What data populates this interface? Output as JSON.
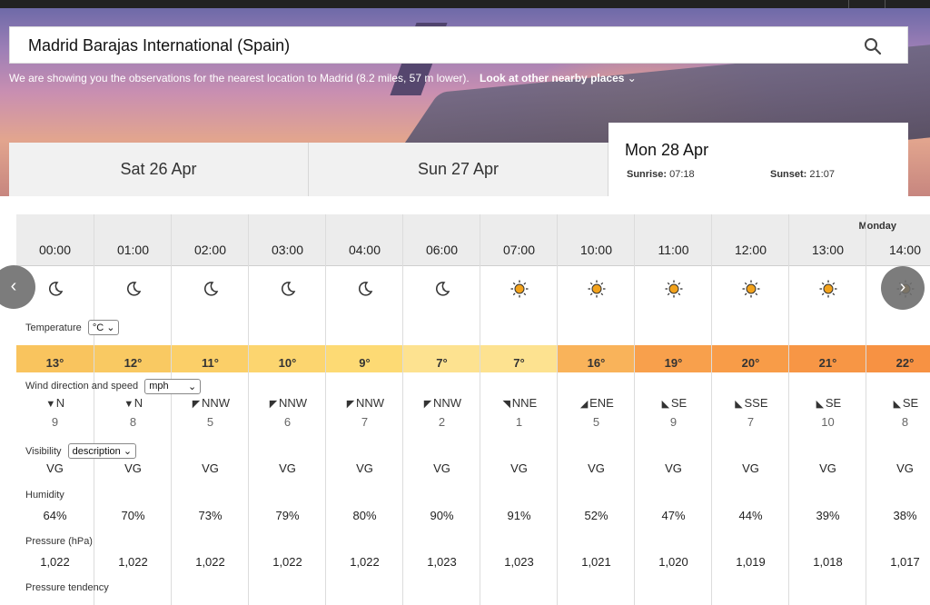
{
  "search": {
    "value": "Madrid Barajas International (Spain)"
  },
  "nearest": {
    "text": "We are showing you the observations for the nearest location to Madrid (8.2 miles, 57 m lower).",
    "link": "Look at other nearby places"
  },
  "days": [
    {
      "label": "Sat 26 Apr"
    },
    {
      "label": "Sun 27 Apr"
    },
    {
      "label": "Mon 28 Apr",
      "sunrise_label": "Sunrise:",
      "sunrise": "07:18",
      "sunset_label": "Sunset:",
      "sunset": "21:07"
    }
  ],
  "table": {
    "day_name": "Monday",
    "labels": {
      "temperature": "Temperature",
      "temp_unit": "°C",
      "wind": "Wind direction and speed",
      "wind_unit": "mph",
      "visibility": "Visibility",
      "visibility_mode": "description",
      "humidity": "Humidity",
      "pressure": "Pressure (hPa)",
      "pressure_tendency": "Pressure tendency"
    },
    "hours": [
      {
        "time": "00:00",
        "icon": "moon-icon",
        "temp": "13°",
        "tempColor": "#f9c45e",
        "arrow": "▼",
        "dir": "N",
        "speed": "9",
        "vis": "VG",
        "hum": "64%",
        "pres": "1,022"
      },
      {
        "time": "01:00",
        "icon": "moon-icon",
        "temp": "12°",
        "tempColor": "#f9c962",
        "arrow": "▼",
        "dir": "N",
        "speed": "8",
        "vis": "VG",
        "hum": "70%",
        "pres": "1,022"
      },
      {
        "time": "02:00",
        "icon": "moon-icon",
        "temp": "11°",
        "tempColor": "#fbcf68",
        "arrow": "◤",
        "dir": "NNW",
        "speed": "5",
        "vis": "VG",
        "hum": "73%",
        "pres": "1,022"
      },
      {
        "time": "03:00",
        "icon": "moon-icon",
        "temp": "10°",
        "tempColor": "#fcd56f",
        "arrow": "◤",
        "dir": "NNW",
        "speed": "6",
        "vis": "VG",
        "hum": "79%",
        "pres": "1,022"
      },
      {
        "time": "04:00",
        "icon": "moon-icon",
        "temp": "9°",
        "tempColor": "#fdda74",
        "arrow": "◤",
        "dir": "NNW",
        "speed": "7",
        "vis": "VG",
        "hum": "80%",
        "pres": "1,022"
      },
      {
        "time": "06:00",
        "icon": "moon-icon",
        "temp": "7°",
        "tempColor": "#fde290",
        "arrow": "◤",
        "dir": "NNW",
        "speed": "2",
        "vis": "VG",
        "hum": "90%",
        "pres": "1,023"
      },
      {
        "time": "07:00",
        "icon": "sun-icon",
        "temp": "7°",
        "tempColor": "#fde290",
        "arrow": "◥",
        "dir": "NNE",
        "speed": "1",
        "vis": "VG",
        "hum": "91%",
        "pres": "1,023"
      },
      {
        "time": "10:00",
        "icon": "sun-icon",
        "temp": "16°",
        "tempColor": "#f9b35a",
        "arrow": "◢",
        "dir": "ENE",
        "speed": "5",
        "vis": "VG",
        "hum": "52%",
        "pres": "1,021"
      },
      {
        "time": "11:00",
        "icon": "sun-icon",
        "temp": "19°",
        "tempColor": "#f8a04c",
        "arrow": "◣",
        "dir": "SE",
        "speed": "9",
        "vis": "VG",
        "hum": "47%",
        "pres": "1,020"
      },
      {
        "time": "12:00",
        "icon": "sun-icon",
        "temp": "20°",
        "tempColor": "#f89c48",
        "arrow": "◣",
        "dir": "SSE",
        "speed": "7",
        "vis": "VG",
        "hum": "44%",
        "pres": "1,019"
      },
      {
        "time": "13:00",
        "icon": "sun-icon",
        "temp": "21°",
        "tempColor": "#f79645",
        "arrow": "◣",
        "dir": "SE",
        "speed": "10",
        "vis": "VG",
        "hum": "39%",
        "pres": "1,018"
      },
      {
        "time": "14:00",
        "icon": "sun-icon",
        "temp": "22°",
        "tempColor": "#f79243",
        "arrow": "◣",
        "dir": "SE",
        "speed": "8",
        "vis": "VG",
        "hum": "38%",
        "pres": "1,017"
      }
    ]
  },
  "colors": {
    "sun": "#f2a21c",
    "moon": "#333333"
  }
}
